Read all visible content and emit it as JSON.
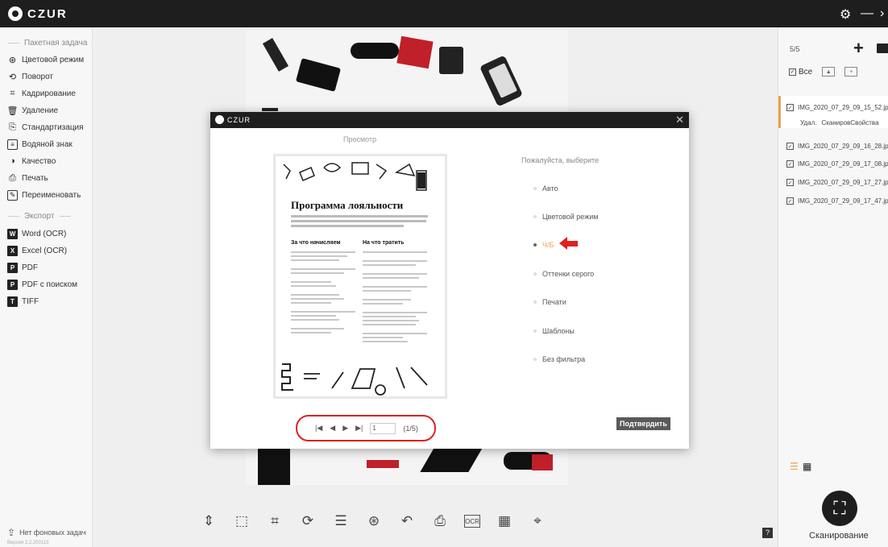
{
  "app": {
    "title": "CZUR"
  },
  "sidebar": {
    "batch_section": "Пакетная задача",
    "items": [
      {
        "label": "Цветовой режим",
        "icon": "color-mode-icon"
      },
      {
        "label": "Поворот",
        "icon": "rotate-icon"
      },
      {
        "label": "Кадрирование",
        "icon": "crop-icon"
      },
      {
        "label": "Удаление",
        "icon": "delete-icon"
      },
      {
        "label": "Стандартизация",
        "icon": "standardize-icon"
      },
      {
        "label": "Водяной знак",
        "icon": "watermark-icon"
      },
      {
        "label": "Качество",
        "icon": "quality-icon"
      },
      {
        "label": "Печать",
        "icon": "print-icon"
      },
      {
        "label": "Переименовать",
        "icon": "rename-icon"
      }
    ],
    "export_section": "Экспорт",
    "export_items": [
      {
        "label": "Word (OCR)",
        "icon": "word-icon",
        "glyph": "W"
      },
      {
        "label": "Excel (OCR)",
        "icon": "excel-icon",
        "glyph": "X"
      },
      {
        "label": "PDF",
        "icon": "pdf-icon",
        "glyph": "P"
      },
      {
        "label": "PDF с поиском",
        "icon": "pdf-search-icon",
        "glyph": "P"
      },
      {
        "label": "TIFF",
        "icon": "tiff-icon",
        "glyph": "T"
      }
    ],
    "background_tasks": "Нет фоновых задач",
    "version": "Версия 2.2.200115"
  },
  "right_panel": {
    "count": "5/5",
    "select_all": "Все",
    "files": [
      "IMG_2020_07_29_09_15_52.jpg",
      "IMG_2020_07_29_09_16_28.jpg",
      "IMG_2020_07_29_09_17_08.jpg",
      "IMG_2020_07_29_09_17_27.jpg",
      "IMG_2020_07_29_09_17_47.jpg"
    ],
    "file_actions": {
      "delete": "Удал.",
      "scan": "Сканиров",
      "props": "Свойства"
    },
    "scan_label": "Сканирование"
  },
  "modal": {
    "title": "CZUR",
    "preview_label": "Просмотр",
    "choose_label": "Пожалуйста, выберите",
    "options": [
      "Авто",
      "Цветовой режим",
      "Ч/Б",
      "Оттенки серого",
      "Печати",
      "Шаблоны",
      "Без фильтра"
    ],
    "selected_index": 2,
    "page_title": "Программа лояльности",
    "col1": "За что начисляем",
    "col2": "На что тратить",
    "pager": {
      "page_value": "1",
      "page_count": "(1/5)"
    },
    "confirm": "Подтвердить"
  },
  "colors": {
    "accent": "#f0a050",
    "highlight": "#e02020",
    "titlebar": "#1e1e1e"
  }
}
